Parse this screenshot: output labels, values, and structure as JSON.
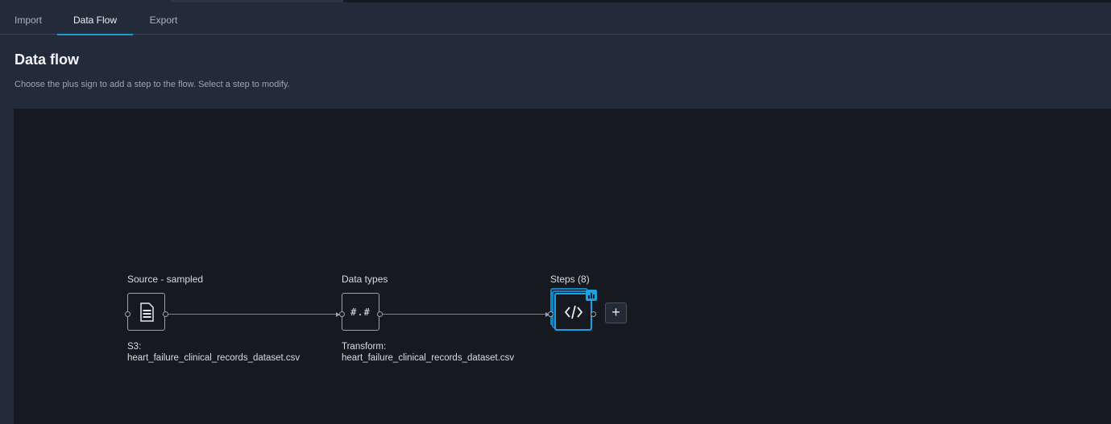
{
  "tabs": [
    {
      "label": "Import"
    },
    {
      "label": "Data Flow"
    },
    {
      "label": "Export"
    }
  ],
  "header": {
    "title": "Data flow",
    "subtitle": "Choose the plus sign to add a step to the flow. Select a step to modify."
  },
  "nodes": {
    "source": {
      "label": "Source - sampled",
      "sub_line1": "S3:",
      "sub_line2": "heart_failure_clinical_records_dataset.csv",
      "icon": "document-icon"
    },
    "datatypes": {
      "label": "Data types",
      "glyph": "#.#",
      "sub_line1": "Transform:",
      "sub_line2": "heart_failure_clinical_records_dataset.csv",
      "icon": "number-format-icon"
    },
    "steps": {
      "label": "Steps (8)",
      "icon": "code-icon",
      "badge_icon": "bar-chart-icon"
    }
  },
  "add_step": {
    "label": "+",
    "icon": "plus-icon"
  },
  "colors": {
    "accent": "#1d9bd1",
    "canvas_bg": "#16191f",
    "page_bg": "#232b3a"
  }
}
